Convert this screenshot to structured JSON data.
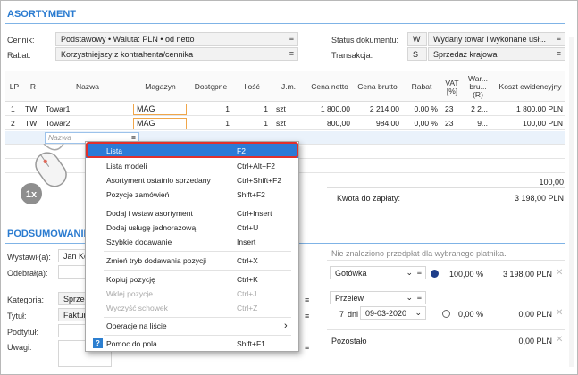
{
  "section_assortment": "ASORTYMENT",
  "section_summary": "PODSUMOWANIE",
  "header": {
    "cennik_label": "Cennik:",
    "cennik_value": "Podstawowy • Waluta: PLN • od netto",
    "rabat_label": "Rabat:",
    "rabat_value": "Korzystniejszy z kontrahenta/cennika",
    "status_label": "Status dokumentu:",
    "status_code": "W",
    "status_value": "Wydany towar i wykonane usł...",
    "transakcja_label": "Transakcja:",
    "transakcja_code": "S",
    "transakcja_value": "Sprzedaż krajowa",
    "dropdown_glyph": "≡"
  },
  "table": {
    "columns": [
      "LP",
      "R",
      "Nazwa",
      "Magazyn",
      "Dostępne",
      "Ilość",
      "J.m.",
      "Cena netto",
      "Cena brutto",
      "Rabat",
      "VAT [%]",
      "War... bru... (R)",
      "Koszt ewidencyjny"
    ],
    "rows": [
      {
        "lp": "1",
        "r": "TW",
        "nazwa": "Towar1",
        "magazyn": "MAG",
        "dostepne": "1",
        "ilosc": "1",
        "jm": "szt",
        "cena_netto": "1 800,00",
        "cena_brutto": "2 214,00",
        "rabat": "0,00 %",
        "vat": "23",
        "wartosc": "2 2...",
        "koszt": "1 800,00 PLN"
      },
      {
        "lp": "2",
        "r": "TW",
        "nazwa": "Towar2",
        "magazyn": "MAG",
        "dostepne": "1",
        "ilosc": "1",
        "jm": "szt",
        "cena_netto": "800,00",
        "cena_brutto": "984,00",
        "rabat": "0,00 %",
        "vat": "23",
        "wartosc": "9...",
        "koszt": "100,00 PLN"
      }
    ],
    "new_row_placeholder": "Nazwa",
    "total_value": "100,00",
    "kwota_label": "Kwota do zapłaty:",
    "kwota_value": "3 198,00 PLN"
  },
  "context_menu": {
    "items": [
      {
        "label": "Lista",
        "key": "F2",
        "state": "selected"
      },
      {
        "label": "Lista modeli",
        "key": "Ctrl+Alt+F2",
        "state": "normal"
      },
      {
        "label": "Asortyment ostatnio sprzedany",
        "key": "Ctrl+Shift+F2",
        "state": "normal"
      },
      {
        "label": "Pozycje zamówień",
        "key": "Shift+F2",
        "state": "normal"
      },
      {
        "label": "Dodaj i wstaw asortyment",
        "key": "Ctrl+Insert",
        "state": "normal"
      },
      {
        "label": "Dodaj usługę jednorazową",
        "key": "Ctrl+U",
        "state": "normal"
      },
      {
        "label": "Szybkie dodawanie",
        "key": "Insert",
        "state": "normal"
      },
      {
        "label": "Zmień tryb dodawania pozycji",
        "key": "Ctrl+X",
        "state": "normal"
      },
      {
        "label": "Kopiuj pozycję",
        "key": "Ctrl+K",
        "state": "normal"
      },
      {
        "label": "Wklej pozycje",
        "key": "Ctrl+J",
        "state": "disabled"
      },
      {
        "label": "Wyczyść schowek",
        "key": "Ctrl+Z",
        "state": "disabled"
      },
      {
        "label": "Operacje na liście",
        "key": "›",
        "state": "normal"
      },
      {
        "label": "Pomoc do pola",
        "key": "Shift+F1",
        "state": "normal"
      }
    ]
  },
  "click_badge": "1x",
  "summary": {
    "wystawil_label": "Wystawił(a):",
    "wystawil_value": "Jan Ko",
    "odebral_label": "Odebrał(a):",
    "kategoria_label": "Kategoria:",
    "kategoria_value": "Sprzed",
    "tytul_label": "Tytuł:",
    "tytul_value": "Faktura",
    "podtytul_label": "Podtytuł:",
    "uwagi_label": "Uwagi:",
    "prepaid_note": "Nie znaleziono przedpłat dla wybranego płatnika.",
    "payment1_method": "Gotówka",
    "payment1_percent": "100,00 %",
    "payment1_amount": "3 198,00 PLN",
    "payment2_method": "Przelew",
    "payment2_days": "7",
    "payment2_days_unit": "dni",
    "payment2_date": "09-03-2020",
    "payment2_percent": "0,00 %",
    "payment2_amount": "0,00 PLN",
    "pozostalo_label": "Pozostało",
    "pozostalo_value": "0,00 PLN"
  },
  "colors": {
    "accent": "#2a7bd0",
    "menu_selected": "#2b7ad6",
    "highlight_ring": "#e0302c",
    "magazyn_border": "#f0a64a"
  }
}
